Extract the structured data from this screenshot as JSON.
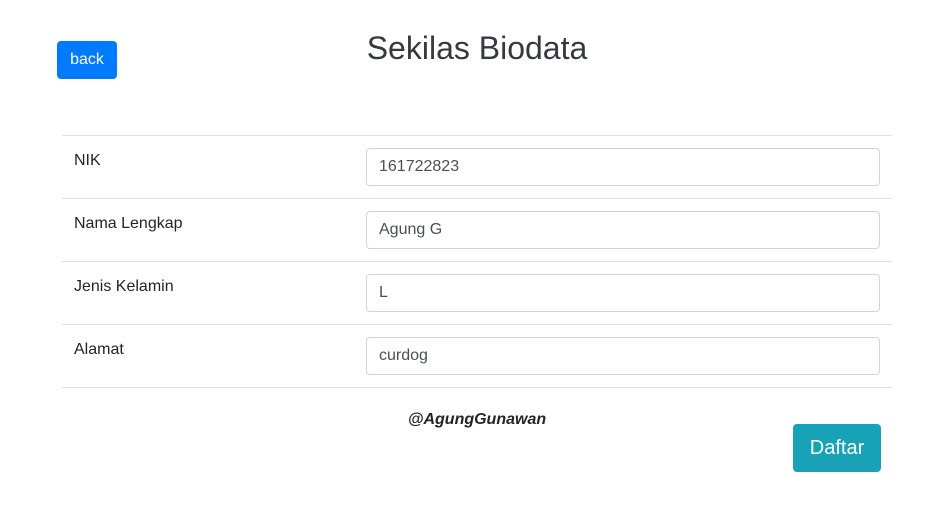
{
  "header": {
    "back_label": "back",
    "title": "Sekilas Biodata"
  },
  "form": {
    "rows": [
      {
        "label": "NIK",
        "value": "161722823"
      },
      {
        "label": "Nama Lengkap",
        "value": "Agung G"
      },
      {
        "label": "Jenis Kelamin",
        "value": "L"
      },
      {
        "label": "Alamat",
        "value": "curdog"
      }
    ]
  },
  "footer": {
    "credit": "@AgungGunawan",
    "submit_label": "Daftar"
  },
  "colors": {
    "primary": "#007bff",
    "info": "#17a2b8",
    "title": "#343a40",
    "border": "#dee2e6"
  }
}
